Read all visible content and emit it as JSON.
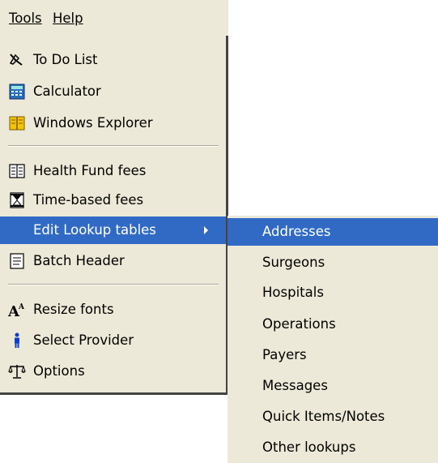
{
  "menubar": {
    "tools": {
      "label": "Tools"
    },
    "help": {
      "label": "Help"
    }
  },
  "tools_menu": {
    "items": [
      {
        "label": "To Do List",
        "icon": "pen-icon"
      },
      {
        "label": "Calculator",
        "icon": "calculator-icon"
      },
      {
        "label": "Windows Explorer",
        "icon": "explorer-icon"
      },
      {
        "label": "Health Fund fees",
        "icon": "book-icon"
      },
      {
        "label": "Time-based fees",
        "icon": "hourglass-icon"
      },
      {
        "label": "Edit Lookup tables",
        "icon": "submenu-arrow-icon",
        "selected": true
      },
      {
        "label": "Batch Header",
        "icon": "document-icon"
      },
      {
        "label": "Resize fonts",
        "icon": "font-size-icon"
      },
      {
        "label": "Select Provider",
        "icon": "person-icon"
      },
      {
        "label": "Options",
        "icon": "scales-icon"
      }
    ]
  },
  "lookup_submenu": {
    "items": [
      {
        "label": "Addresses",
        "selected": true
      },
      {
        "label": "Surgeons"
      },
      {
        "label": "Hospitals"
      },
      {
        "label": "Operations"
      },
      {
        "label": "Payers"
      },
      {
        "label": "Messages"
      },
      {
        "label": "Quick Items/Notes"
      },
      {
        "label": "Other lookups"
      }
    ]
  },
  "colors": {
    "menu_background": "#ece9d8",
    "selection": "#316ac5",
    "shadow": "#444444"
  }
}
